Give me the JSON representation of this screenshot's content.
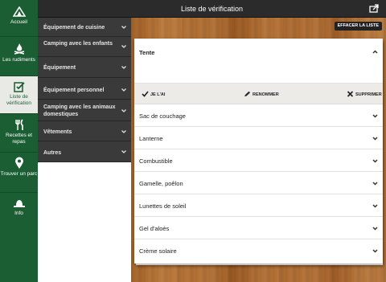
{
  "app": {
    "title": "Liste de vérification"
  },
  "nav": {
    "items": [
      {
        "label": "Accueil"
      },
      {
        "label": "Les rudiments"
      },
      {
        "label": "Liste de vérification"
      },
      {
        "label": "Recettes et repas"
      },
      {
        "label": "Trouver un parc"
      },
      {
        "label": "Info"
      }
    ],
    "active": "Liste de vérification"
  },
  "categories": [
    {
      "label": "Équipement de cuisine"
    },
    {
      "label": "Camping avec les enfants"
    },
    {
      "label": "Équipement"
    },
    {
      "label": "Équipement personnel"
    },
    {
      "label": "Camping avec les animaux domestiques"
    },
    {
      "label": "Vêtements"
    },
    {
      "label": "Autres"
    }
  ],
  "toolbar": {
    "clear_label": "EFFACER LA LISTE"
  },
  "checklist": {
    "items": [
      {
        "label": "Tente",
        "expanded": true
      },
      {
        "label": "Sac de couchage"
      },
      {
        "label": "Lanterne"
      },
      {
        "label": "Combustible"
      },
      {
        "label": "Gamelle, poêlon"
      },
      {
        "label": "Lunettes de soleil"
      },
      {
        "label": "Gel d'aloès"
      },
      {
        "label": "Crème solaire"
      }
    ],
    "actions": {
      "have": "JE L'AI",
      "rename": "RENOMMER",
      "delete": "SUPPRIMER"
    }
  },
  "colors": {
    "nav_green": "#1b5e34",
    "dark_panel": "#3a3a3a",
    "wood": "#a8662b"
  }
}
